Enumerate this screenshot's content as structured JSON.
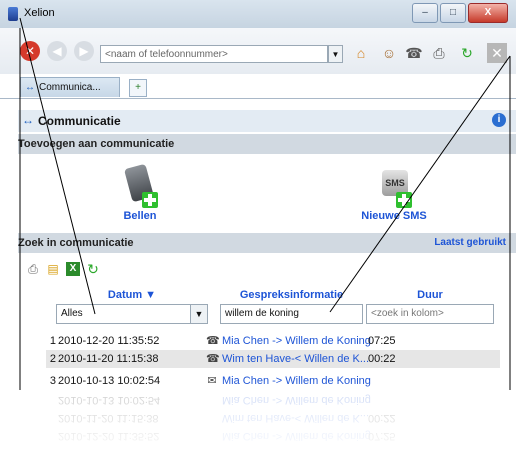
{
  "window": {
    "title": "Xelion"
  },
  "toolbar": {
    "address_placeholder": "<naam of telefoonnummer>",
    "icons": [
      "stop-icon",
      "back-icon",
      "forward-icon",
      "home-icon",
      "people-icon",
      "phone-icon",
      "print-icon",
      "refresh-icon",
      "close-icon"
    ]
  },
  "tabs": {
    "active_label": "Communica...",
    "add_label": "+"
  },
  "header": {
    "title": "Communicatie",
    "info": "i"
  },
  "sections": {
    "add": "Toevoegen aan communicatie",
    "search": "Zoek in communicatie",
    "recent_link": "Laatst gebruikt"
  },
  "actions": {
    "bellen": "Bellen",
    "sms": "Nieuwe SMS",
    "sms_icon_text": "SMS"
  },
  "table": {
    "col_date": "Datum ▼",
    "col_info": "Gespreksinformatie",
    "col_duur": "Duur",
    "filter_date": "Alles",
    "filter_info": "willem de koning",
    "filter_duur": "<zoek in kolom>",
    "rows": [
      {
        "idx": "1",
        "date": "2010-12-20 11:35:52",
        "type": "phone-icon",
        "info": "Mia Chen -> Willem de Koning",
        "duur": "07:25"
      },
      {
        "idx": "2",
        "date": "2010-11-20 11:15:38",
        "type": "phone-icon",
        "info": "Wim ten Have-< Willen de K...",
        "duur": "00:22"
      },
      {
        "idx": "3",
        "date": "2010-10-13 10:02:54",
        "type": "sms-icon",
        "info": "Mia Chen -> Willem de Koning",
        "duur": ""
      }
    ]
  },
  "colors": {
    "link": "#1d54d6",
    "section": "#d1d9e1",
    "header": "#e3ebf3"
  }
}
